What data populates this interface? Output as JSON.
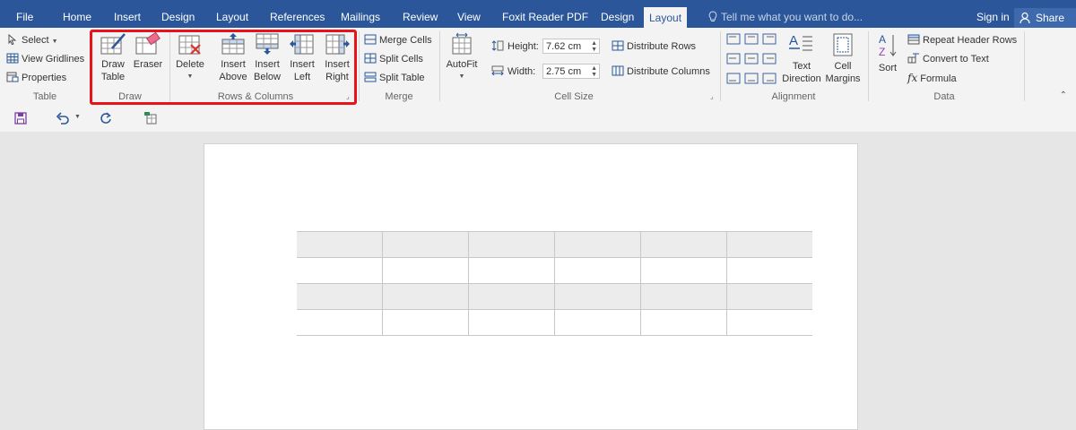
{
  "tabs": [
    {
      "label": "File",
      "active": false
    },
    {
      "label": "Home",
      "active": false
    },
    {
      "label": "Insert",
      "active": false
    },
    {
      "label": "Design",
      "active": false
    },
    {
      "label": "Layout",
      "active": false
    },
    {
      "label": "References",
      "active": false
    },
    {
      "label": "Mailings",
      "active": false
    },
    {
      "label": "Review",
      "active": false
    },
    {
      "label": "View",
      "active": false
    },
    {
      "label": "Foxit Reader PDF",
      "active": false
    },
    {
      "label": "Design",
      "active": false
    },
    {
      "label": "Layout",
      "active": true
    }
  ],
  "tell_me": "Tell me what you want to do...",
  "sign_in": "Sign in",
  "share": "Share",
  "ribbon": {
    "table": {
      "select": "Select",
      "view_gridlines": "View Gridlines",
      "properties": "Properties",
      "label": "Table"
    },
    "draw": {
      "draw_table_1": "Draw",
      "draw_table_2": "Table",
      "eraser": "Eraser",
      "label": "Draw"
    },
    "rows_columns": {
      "delete": "Delete",
      "insert_above_1": "Insert",
      "insert_above_2": "Above",
      "insert_below_1": "Insert",
      "insert_below_2": "Below",
      "insert_left_1": "Insert",
      "insert_left_2": "Left",
      "insert_right_1": "Insert",
      "insert_right_2": "Right",
      "label": "Rows & Columns"
    },
    "merge": {
      "merge_cells": "Merge Cells",
      "split_cells": "Split Cells",
      "split_table": "Split Table",
      "label": "Merge"
    },
    "cell_size": {
      "autofit": "AutoFit",
      "height_label": "Height:",
      "height_value": "7.62 cm",
      "width_label": "Width:",
      "width_value": "2.75 cm",
      "distribute_rows": "Distribute Rows",
      "distribute_columns": "Distribute Columns",
      "label": "Cell Size"
    },
    "alignment": {
      "text_direction_1": "Text",
      "text_direction_2": "Direction",
      "cell_margins_1": "Cell",
      "cell_margins_2": "Margins",
      "label": "Alignment"
    },
    "data": {
      "sort": "Sort",
      "repeat_header_rows": "Repeat Header Rows",
      "convert_to_text": "Convert to Text",
      "formula": "Formula",
      "label": "Data"
    }
  },
  "colors": {
    "ribbon_blue": "#2b579a",
    "highlight": "#e8121a",
    "accent_icon": "#2b579a",
    "delete_red": "#d9342b"
  },
  "document": {
    "table_rows": 4,
    "table_cols": 6,
    "shaded_rows": [
      0,
      2
    ]
  }
}
